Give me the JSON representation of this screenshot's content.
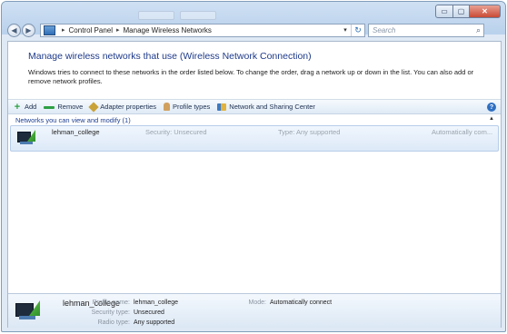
{
  "window": {
    "caption_buttons": {
      "minimize": "▭",
      "maximize": "▢",
      "close": "✕"
    }
  },
  "address": {
    "nav_back_icon": "back-arrow-icon",
    "nav_forward_icon": "forward-arrow-icon",
    "crumbs": [
      "Control Panel",
      "Manage Wireless Networks"
    ],
    "separator": "▸",
    "dropdown": "▾",
    "refresh": "↻",
    "search_placeholder": "Search",
    "search_glyph": "⌕"
  },
  "main": {
    "heading": "Manage wireless networks that use (Wireless Network Connection)",
    "description": "Windows tries to connect to these networks in the order listed below. To change the order, drag a network up or down in the list. You can also add or remove network profiles."
  },
  "toolbar": {
    "items": [
      {
        "label": "Add",
        "icon": "add-icon"
      },
      {
        "label": "Remove",
        "icon": "remove-icon"
      },
      {
        "label": "Adapter properties",
        "icon": "adapter-icon"
      },
      {
        "label": "Profile types",
        "icon": "profile-types-icon"
      },
      {
        "label": "Network and Sharing Center",
        "icon": "sharing-center-icon"
      }
    ],
    "help": "?"
  },
  "group": {
    "label": "Networks you can view and modify (1)",
    "collapse_glyph": "▲"
  },
  "networks": [
    {
      "name": "lehman_college",
      "security": "Security: Unsecured",
      "type": "Type: Any supported",
      "mode": "Automatically com..."
    }
  ],
  "details": {
    "name": "lehman_college",
    "profile_name_label": "Profile name:",
    "profile_name_value": "lehman_college",
    "security_type_label": "Security type:",
    "security_type_value": "Unsecured",
    "radio_type_label": "Radio type:",
    "radio_type_value": "Any supported",
    "mode_label": "Mode:",
    "mode_value": "Automatically connect"
  }
}
